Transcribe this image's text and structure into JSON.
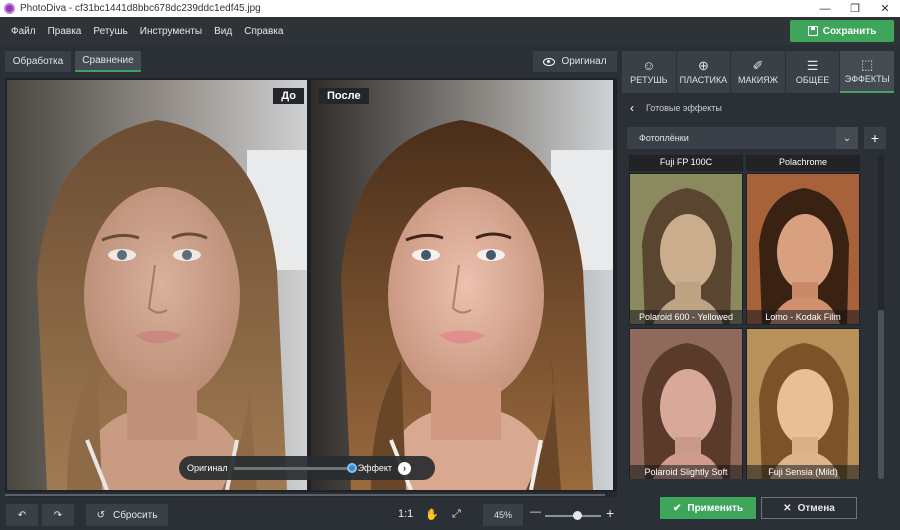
{
  "window": {
    "title": "PhotoDiva - cf31bc1441d8bbc678dc239ddc1edf45.jpg",
    "minimize": "—",
    "maximize": "❐",
    "close": "✕"
  },
  "menu": {
    "items": [
      "Файл",
      "Правка",
      "Ретушь",
      "Инструменты",
      "Вид",
      "Справка"
    ],
    "save_label": "Сохранить"
  },
  "toolbar": {
    "tabs": [
      "Обработка",
      "Сравнение"
    ],
    "active_tab": "Сравнение",
    "original_label": "Оригинал"
  },
  "photos": {
    "before_label": "До",
    "after_label": "После"
  },
  "compare": {
    "left_label": "Оригинал",
    "right_label": "Эффект",
    "level": 1.0
  },
  "bottom": {
    "reset_label": "Сбросить",
    "actual_size": "1:1",
    "zoom": "45%",
    "minus": "—",
    "plus": "+",
    "zoom_level": 0.57
  },
  "panel": {
    "tabs": [
      {
        "label": "РЕТУШЬ",
        "icon": "retouch-icon",
        "glyph": "☺"
      },
      {
        "label": "ПЛАСТИКА",
        "icon": "plastic-icon",
        "glyph": "⊕"
      },
      {
        "label": "МАКИЯЖ",
        "icon": "makeup-icon",
        "glyph": "✐"
      },
      {
        "label": "ОБЩЕЕ",
        "icon": "sliders-icon",
        "glyph": "☰"
      },
      {
        "label": "ЭФФЕКТЫ",
        "icon": "effects-icon",
        "glyph": "⬚"
      }
    ],
    "active_tab": "ЭФФЕКТЫ",
    "section_title": "Готовые эффекты",
    "dropdown_value": "Фотоплёнки",
    "apply_label": "Применить",
    "cancel_label": "Отмена",
    "thumbnails_top": [
      "Fuji FP 100C",
      "Polachrome"
    ],
    "thumbnails": [
      {
        "label": "Polaroid 600 - Yellowed",
        "tint": "#8a8a5e"
      },
      {
        "label": "Lomo - Kodak Film",
        "tint": "#a8623a"
      },
      {
        "label": "Polaroid Slightly Soft",
        "tint": "#8f6a5c"
      },
      {
        "label": "Fuji Sensia (Mild)",
        "tint": "#b8905a"
      }
    ]
  },
  "colors": {
    "accent": "#3ea65a",
    "background": "#2b3036",
    "knob": "#2e8fd8"
  }
}
